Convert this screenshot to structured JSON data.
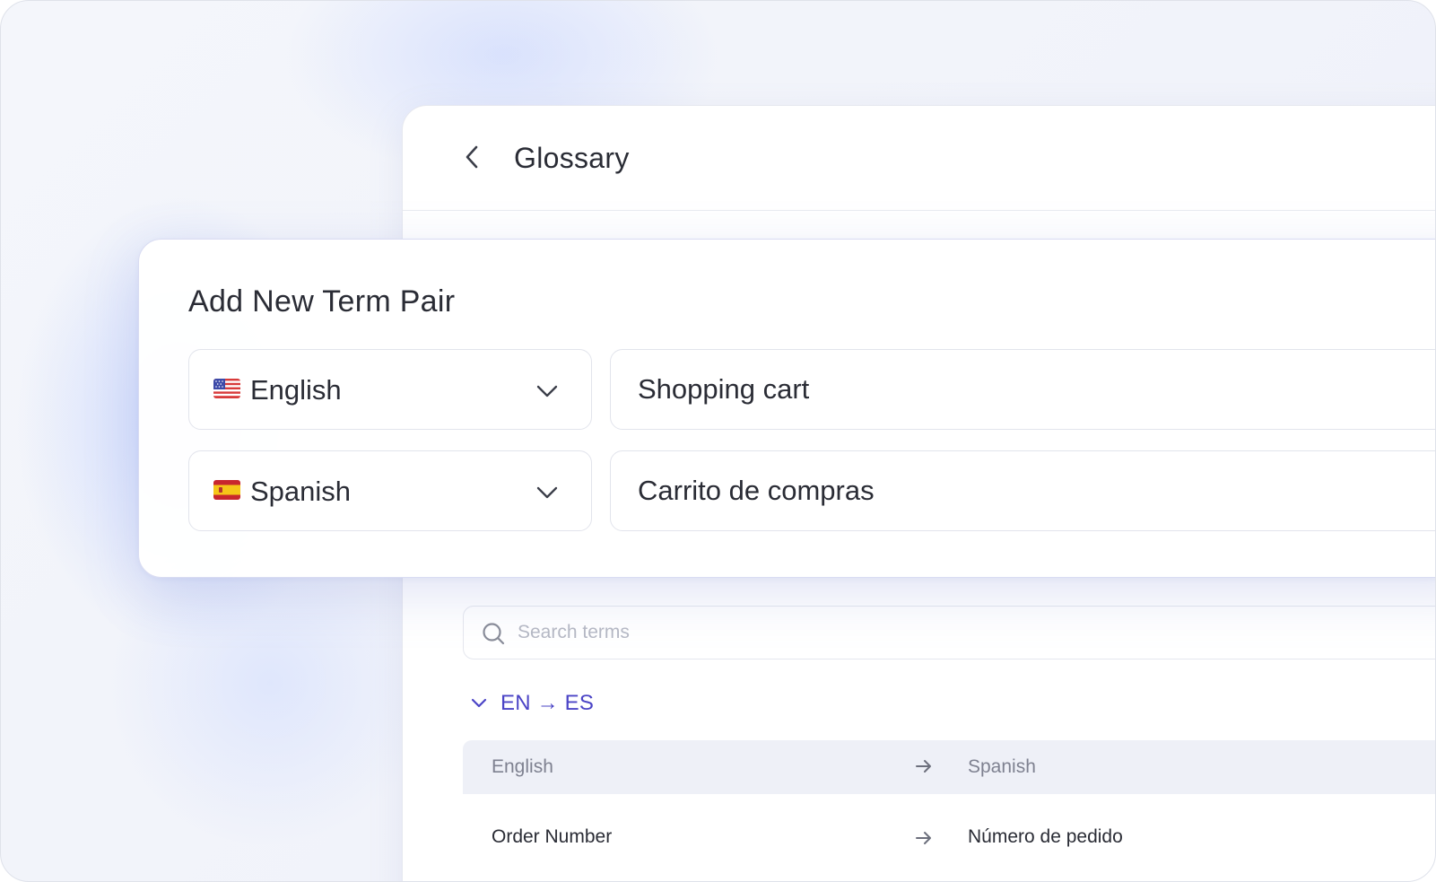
{
  "header": {
    "title": "Glossary",
    "back_icon": "chevron-left-icon"
  },
  "add_term": {
    "title": "Add New Term Pair",
    "source": {
      "language": "English",
      "flag": "us-flag-icon",
      "term": "Shopping cart"
    },
    "target": {
      "language": "Spanish",
      "flag": "es-flag-icon",
      "term": "Carrito de compras"
    }
  },
  "search": {
    "placeholder": "Search terms",
    "value": ""
  },
  "group": {
    "label": "EN → ES",
    "expanded": true
  },
  "table": {
    "columns": [
      "English",
      "Spanish"
    ],
    "rows": [
      {
        "en": "Order Number",
        "es": "Número de pedido"
      }
    ]
  },
  "colors": {
    "accent": "#4b44c6",
    "text": "#2a2c35",
    "muted": "#7e8190",
    "header_bg": "#eef0f7"
  }
}
